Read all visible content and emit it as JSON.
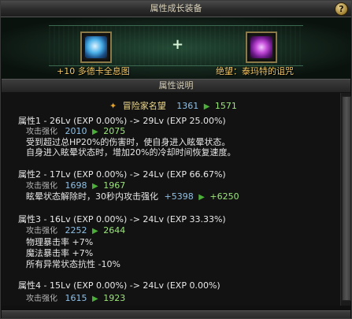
{
  "window": {
    "title": "属性成长装备",
    "help_label": "?"
  },
  "banner": {
    "left_item": "+10 多德卡全息图",
    "right_item": "绝望：泰玛特的诅咒",
    "plus": "+"
  },
  "section": {
    "title": "属性说明",
    "bottom_title": ""
  },
  "adventure": {
    "label": "冒险家名望",
    "from": "1361",
    "to": "1571"
  },
  "attributes": [
    {
      "header": "属性1 - 26Lv (EXP 0.00%) -> 29Lv (EXP 25.00%)",
      "sub_label": "攻击强化",
      "sub_from": "2010",
      "sub_to": "2075",
      "desc": [
        "受到超过总HP20%的伤害时，使自身进入眩晕状态。",
        "自身进入眩晕状态时，增加20%的冷却时间恢复速度。"
      ]
    },
    {
      "header": "属性2 - 17Lv (EXP 0.00%) -> 24Lv (EXP 66.67%)",
      "sub_label": "攻击强化",
      "sub_from": "1698",
      "sub_to": "1967",
      "desc_prefix": "眩晕状态解除时，30秒内攻击强化",
      "desc_from": "+5398",
      "desc_to": "+6250"
    },
    {
      "header": "属性3 - 16Lv (EXP 0.00%) -> 24Lv (EXP 33.33%)",
      "sub_label": "攻击强化",
      "sub_from": "2252",
      "sub_to": "2644",
      "desc": [
        "物理暴击率 +7%",
        "魔法暴击率 +7%",
        "所有异常状态抗性 -10%"
      ]
    },
    {
      "header": "属性4 - 15Lv (EXP 0.00%) -> 24Lv (EXP 0.00%)",
      "sub_label": "攻击强化",
      "sub_from": "1615",
      "sub_to": "1923"
    }
  ]
}
